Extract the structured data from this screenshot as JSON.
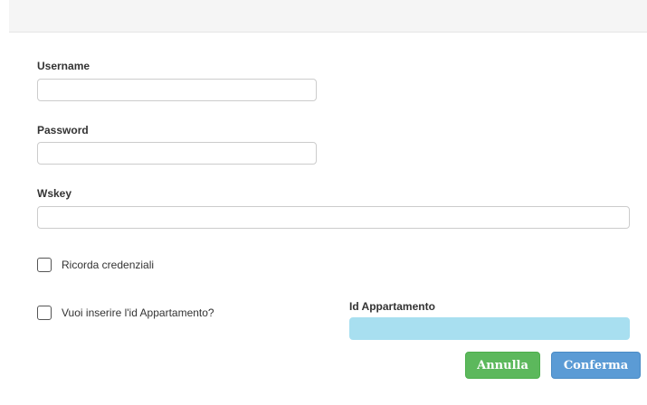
{
  "form": {
    "username": {
      "label": "Username",
      "value": ""
    },
    "password": {
      "label": "Password",
      "value": ""
    },
    "wskey": {
      "label": "Wskey",
      "value": ""
    },
    "remember_credentials": {
      "label": "Ricorda credenziali",
      "checked": false
    },
    "insert_apartment_id": {
      "label": "Vuoi inserire l'id Appartamento?",
      "checked": false
    },
    "apartment_id": {
      "label": "Id Appartamento",
      "value": "",
      "disabled": true
    }
  },
  "buttons": {
    "cancel_label": "Annulla",
    "confirm_label": "Conferma"
  },
  "colors": {
    "cancel_button": "#5cb85c",
    "confirm_button": "#5b9bd5",
    "disabled_field": "#a8dff0"
  }
}
